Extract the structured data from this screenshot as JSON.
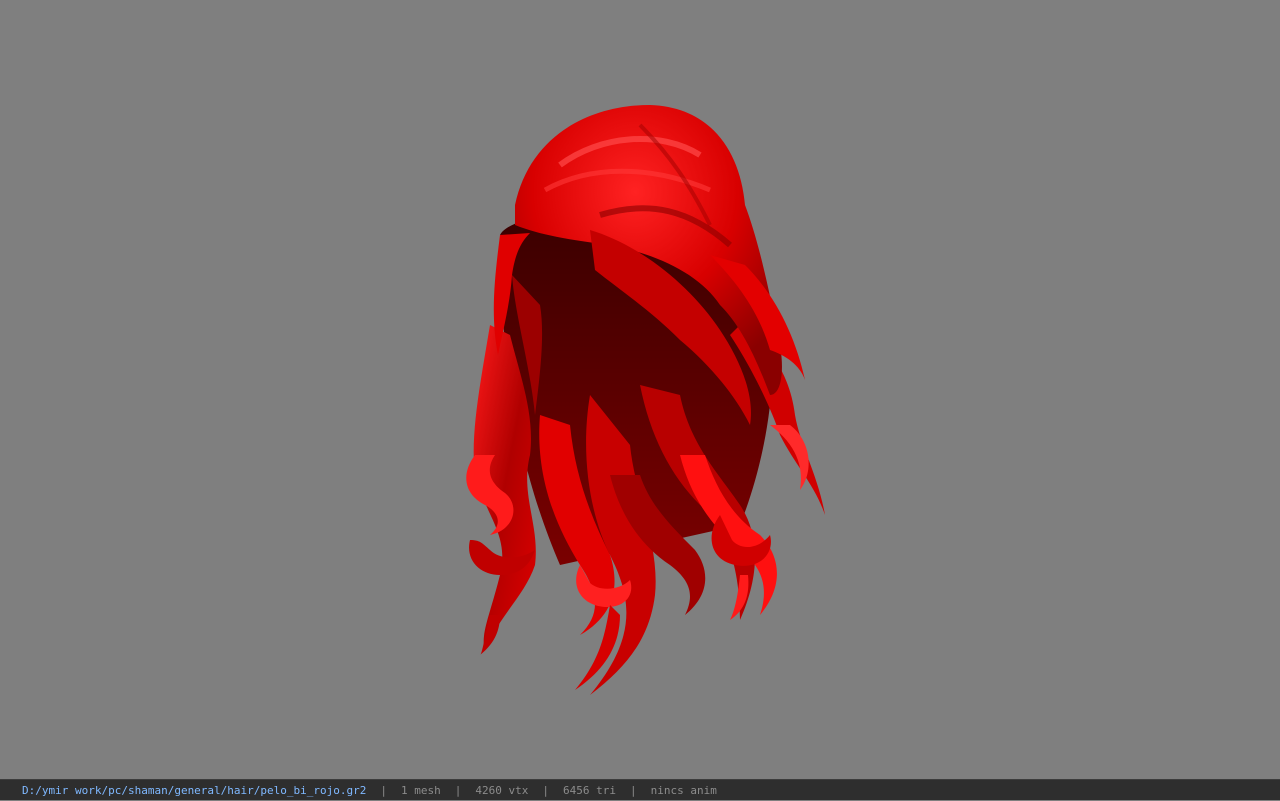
{
  "viewer": {
    "background_color": "#7f7f7f",
    "model": {
      "name": "pelo_bi_rojo",
      "hair_color": "#e00000",
      "hair_shadow_color": "#4a0000"
    }
  },
  "status_bar": {
    "file_path": "D:/ymir work/pc/shaman/general/hair/pelo_bi_rojo.gr2",
    "separator": "|",
    "mesh_count": "1 mesh",
    "vertex_count": "4260 vtx",
    "triangle_count": "6456 tri",
    "anim_status": "nincs anim"
  }
}
